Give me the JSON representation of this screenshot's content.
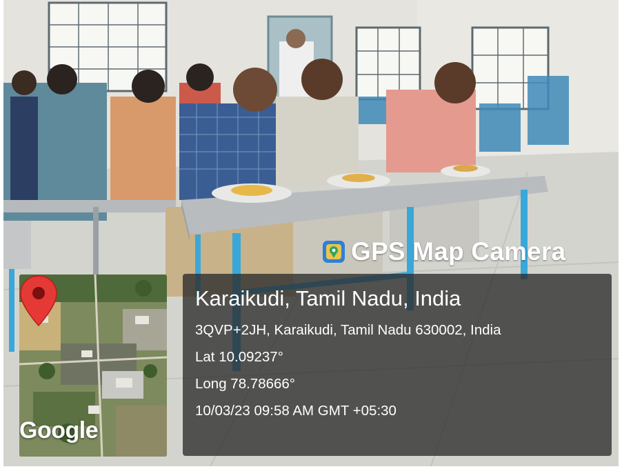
{
  "overlay": {
    "app_name": "GPS Map Camera",
    "place": "Karaikudi, Tamil Nadu, India",
    "address": "3QVP+2JH, Karaikudi, Tamil Nadu 630002, India",
    "latitude": "Lat 10.09237°",
    "longitude": "Long 78.78666°",
    "datetime": "10/03/23 09:58 AM GMT +05:30"
  },
  "map": {
    "attribution": "Google",
    "pin_icon": "map-pin-icon",
    "pin_color": "#e53935"
  },
  "scene": {
    "table_color": "#b9bcbf",
    "table_leg_color": "#3aa7d9",
    "floor_color": "#d6d6d2"
  }
}
